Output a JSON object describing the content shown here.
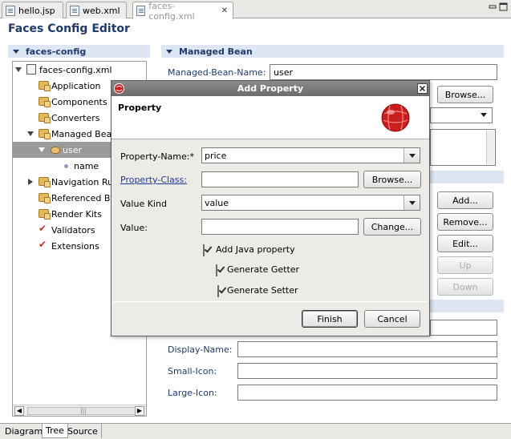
{
  "tabs": [
    {
      "label": "hello.jsp",
      "icon": "jsp-file-icon"
    },
    {
      "label": "web.xml",
      "icon": "xml-file-icon"
    },
    {
      "label": "faces-config.xml",
      "icon": "xml-file-icon",
      "close": "✕"
    }
  ],
  "window_controls": {
    "minimize": "minimize-icon",
    "maximize": "maximize-icon"
  },
  "editor_title": "Faces Config Editor",
  "tree_section_title": "faces-config",
  "tree": [
    {
      "label": "faces-config.xml"
    },
    {
      "label": "Application"
    },
    {
      "label": "Components"
    },
    {
      "label": "Converters"
    },
    {
      "label": "Managed Bean"
    },
    {
      "label": "user"
    },
    {
      "label": "name"
    },
    {
      "label": "Navigation Rule"
    },
    {
      "label": "Referenced Be"
    },
    {
      "label": "Render Kits"
    },
    {
      "label": "Validators"
    },
    {
      "label": "Extensions"
    }
  ],
  "bottom_tabs": [
    "Diagram",
    "Tree",
    "Source"
  ],
  "managed_bean": {
    "section_title": "Managed Bean",
    "name_label": "Managed-Bean-Name:",
    "name_value": "user",
    "browse": "Browse...",
    "buttons": [
      "Add...",
      "Remove...",
      "Edit...",
      "Up",
      "Down"
    ],
    "display_name_label": "Display-Name:",
    "small_icon_label": "Small-Icon:",
    "large_icon_label": "Large-Icon:"
  },
  "dialog": {
    "title": "Add Property",
    "header": "Property",
    "property_name_label": "Property-Name:*",
    "property_name_value": "price",
    "property_class_label": "Property-Class:",
    "property_class_value": "",
    "browse": "Browse...",
    "value_kind_label": "Value Kind",
    "value_kind_value": "value",
    "value_label": "Value:",
    "value_value": "",
    "change": "Change...",
    "add_java_property": "Add Java property",
    "generate_getter": "Generate Getter",
    "generate_setter": "Generate Setter",
    "add_java_property_checked": true,
    "generate_getter_checked": true,
    "generate_setter_checked": true,
    "finish": "Finish",
    "cancel": "Cancel"
  }
}
